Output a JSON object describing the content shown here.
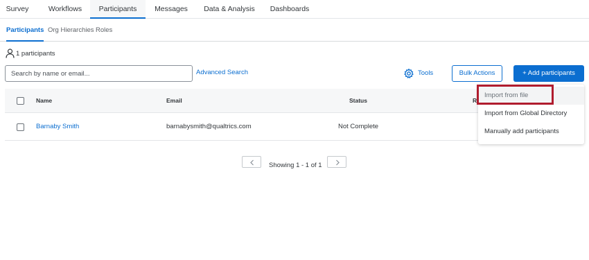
{
  "topnav": {
    "tabs": [
      {
        "label": "Survey"
      },
      {
        "label": "Workflows"
      },
      {
        "label": "Participants"
      },
      {
        "label": "Messages"
      },
      {
        "label": "Data & Analysis"
      },
      {
        "label": "Dashboards"
      }
    ],
    "active": "Participants"
  },
  "subnav": {
    "tabs": [
      {
        "label": "Participants"
      },
      {
        "label": "Org Hierarchies"
      },
      {
        "label": "Roles"
      }
    ],
    "active": "Participants"
  },
  "participants_count": "1 participants",
  "search": {
    "placeholder": "Search by name or email...",
    "value": ""
  },
  "toolbar": {
    "advanced_search": "Advanced Search",
    "tools": "Tools",
    "bulk_actions": "Bulk Actions",
    "add_participants": "+ Add participants"
  },
  "table": {
    "headers": {
      "name": "Name",
      "email": "Email",
      "status": "Status",
      "role_partial": "Ro"
    },
    "rows": [
      {
        "name": "Barnaby Smith",
        "email": "barnabysmith@qualtrics.com",
        "status": "Not Complete"
      }
    ]
  },
  "pagination": {
    "info": "Showing 1 - 1 of 1"
  },
  "add_menu": {
    "items": [
      {
        "label": "Import from file"
      },
      {
        "label": "Import from Global Directory"
      },
      {
        "label": "Manually add participants"
      }
    ],
    "highlighted": "Import from file"
  },
  "colors": {
    "accent": "#0b6ed0",
    "highlight_border": "#b01c2e"
  },
  "icons": {
    "count": "person-icon",
    "tools": "gear-icon",
    "prev": "chevron-left-icon",
    "next": "chevron-right-icon"
  }
}
